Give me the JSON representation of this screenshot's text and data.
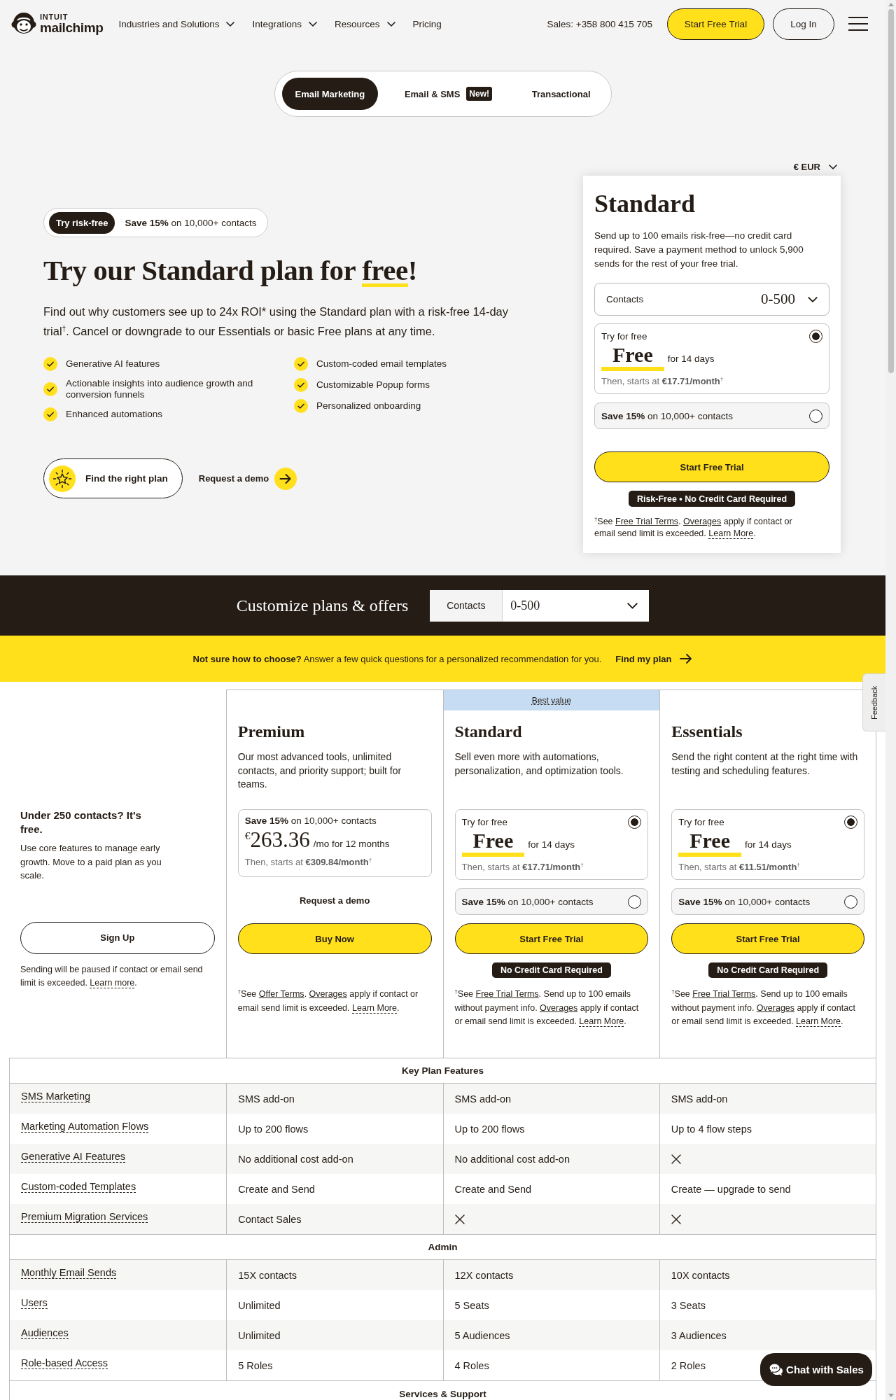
{
  "header": {
    "logo": {
      "brand": "INTUIT",
      "name": "mailchimp"
    },
    "nav": [
      {
        "label": "Industries and Solutions",
        "dropdown": true
      },
      {
        "label": "Integrations",
        "dropdown": true
      },
      {
        "label": "Resources",
        "dropdown": true
      },
      {
        "label": "Pricing",
        "dropdown": false
      }
    ],
    "sales": "Sales: +358 800 415 705",
    "buttons": [
      {
        "label": "Start Free Trial",
        "kind": "primary"
      },
      {
        "label": "Log In",
        "kind": "outline"
      }
    ]
  },
  "product_tabs": [
    {
      "label": "Email Marketing",
      "selected": true
    },
    {
      "label": "Email & SMS",
      "badge": "New!",
      "selected": false
    },
    {
      "label": "Transactional",
      "selected": false
    }
  ],
  "hero": {
    "offer": {
      "tag": "Try risk-free",
      "text": "**Save 15%** on 10,000+ contacts"
    },
    "title": {
      "before": "Try our Standard plan for",
      "highlight": "free",
      "after": "!"
    },
    "intro": "Find out why customers see up to 24x ROI* using the Standard plan with a risk-free 14-day trial$^{†}$. Cancel or downgrade to our Essentials or basic Free plans at any time.",
    "features": [
      [
        "Generative AI features",
        "Actionable insights into audience growth and conversion funnels",
        "Enhanced automations"
      ],
      [
        "Custom-coded email templates",
        "Customizable Popup forms",
        "Personalized onboarding"
      ]
    ],
    "actions": [
      {
        "kind": "finder",
        "label": "Find the right plan"
      },
      {
        "kind": "demo",
        "label": "Request a demo"
      }
    ],
    "currency": "€ EUR",
    "card": {
      "title": "Standard",
      "description": "Send up to 100 emails risk-free—no credit card required. Save a payment method to unlock 5,900 sends for the rest of your free trial.",
      "contacts": {
        "label": "Contacts",
        "value": "0-500"
      },
      "options": [
        {
          "kind": "trial",
          "label": "Try for free",
          "price": "Free",
          "period": "for 14 days",
          "then": "Then, starts at **€17.71/month**$^{†}$",
          "selected": true
        },
        {
          "kind": "discount",
          "text": "**Save 15%** on 10,000+ contacts",
          "selected": false
        }
      ],
      "button": "Start Free Trial",
      "tag": "Risk-Free • No Credit Card Required",
      "footnote": [
        {
          "kind": "text",
          "text": "$^{†}$See "
        },
        {
          "kind": "link",
          "text": "Free Trial Terms"
        },
        {
          "kind": "text",
          "text": ". "
        },
        {
          "kind": "link",
          "text": "Overages"
        },
        {
          "kind": "text",
          "text": " apply if contact or email send limit is exceeded. "
        },
        {
          "kind": "tooltip",
          "text": "Learn More"
        },
        {
          "kind": "text",
          "text": "."
        }
      ]
    }
  },
  "customize": {
    "title": "Customize plans & offers",
    "contacts": {
      "label": "Contacts",
      "value": "0-500"
    }
  },
  "helper": {
    "text": "**Not sure how to choose?** Answer a few quick questions for a personalized recommendation for you.",
    "link": "Find my plan"
  },
  "free_plan": {
    "title": "Under 250 contacts? It's free.",
    "description": "Use core features to manage early growth. Move to a paid plan as you scale.",
    "button": "Sign Up",
    "note": [
      {
        "kind": "text",
        "text": "Sending will be paused if contact or email send limit is exceeded. "
      },
      {
        "kind": "tooltip",
        "text": "Learn more"
      },
      {
        "kind": "text",
        "text": "."
      }
    ]
  },
  "plans": [
    {
      "name": "Premium",
      "description": "Our most advanced tools, unlimited contacts, and priority support; built for teams.",
      "options": [
        {
          "kind": "offer",
          "label": "**Save 15%** on 10,000+ contacts",
          "price": "$^{€}$263.36",
          "period": "/mo for 12 months",
          "then": "Then, starts at **€309.84/month**$^{†}$"
        }
      ],
      "demo_link": "Request a demo",
      "button": "Buy Now",
      "footnote": [
        {
          "kind": "text",
          "text": "$^{†}$See "
        },
        {
          "kind": "link",
          "text": "Offer Terms"
        },
        {
          "kind": "text",
          "text": ". "
        },
        {
          "kind": "link",
          "text": "Overages"
        },
        {
          "kind": "text",
          "text": " apply if contact or email send limit is exceeded. "
        },
        {
          "kind": "tooltip",
          "text": "Learn More"
        },
        {
          "kind": "text",
          "text": "."
        }
      ]
    },
    {
      "name": "Standard",
      "banner": "Best value",
      "description": "Sell even more with automations, personalization, and optimization tools.",
      "options": [
        {
          "kind": "trial",
          "label": "Try for free",
          "price": "Free",
          "period": "for 14 days",
          "then": "Then, starts at **€17.71/month**$^{†}$",
          "selected": true
        },
        {
          "kind": "discount",
          "text": "**Save 15%** on 10,000+ contacts",
          "selected": false
        }
      ],
      "button": "Start Free Trial",
      "tag": "No Credit Card Required",
      "footnote": [
        {
          "kind": "text",
          "text": "$^{†}$See "
        },
        {
          "kind": "link",
          "text": "Free Trial Terms"
        },
        {
          "kind": "text",
          "text": ". Send up to 100 emails without payment info. "
        },
        {
          "kind": "link",
          "text": "Overages"
        },
        {
          "kind": "text",
          "text": " apply if contact or email send limit is exceeded. "
        },
        {
          "kind": "tooltip",
          "text": "Learn More"
        },
        {
          "kind": "text",
          "text": "."
        }
      ]
    },
    {
      "name": "Essentials",
      "description": "Send the right content at the right time with testing and scheduling features.",
      "options": [
        {
          "kind": "trial",
          "label": "Try for free",
          "price": "Free",
          "period": "for 14 days",
          "then": "Then, starts at **€11.51/month**$^{†}$",
          "selected": true
        },
        {
          "kind": "discount",
          "text": "**Save 15%** on 10,000+ contacts",
          "selected": false
        }
      ],
      "button": "Start Free Trial",
      "tag": "No Credit Card Required",
      "footnote": [
        {
          "kind": "text",
          "text": "$^{†}$See "
        },
        {
          "kind": "link",
          "text": "Free Trial Terms"
        },
        {
          "kind": "text",
          "text": ". Send up to 100 emails without payment info. "
        },
        {
          "kind": "link",
          "text": "Overages"
        },
        {
          "kind": "text",
          "text": " apply if contact or email send limit is exceeded. "
        },
        {
          "kind": "tooltip",
          "text": "Learn More"
        },
        {
          "kind": "text",
          "text": "."
        }
      ]
    }
  ],
  "comparison": {
    "sections": [
      {
        "title": "Key Plan Features",
        "rows": [
          {
            "feature": "SMS Marketing",
            "cells": [
              {
                "kind": "text",
                "text": "SMS add-on"
              },
              {
                "kind": "text",
                "text": "SMS add-on"
              },
              {
                "kind": "text",
                "text": "SMS add-on"
              }
            ]
          },
          {
            "feature": "Marketing Automation Flows",
            "cells": [
              {
                "kind": "text",
                "text": "Up to 200 flows"
              },
              {
                "kind": "text",
                "text": "Up to 200 flows"
              },
              {
                "kind": "text",
                "text": "Up to 4 flow steps"
              }
            ]
          },
          {
            "feature": "Generative AI Features",
            "cells": [
              {
                "kind": "text",
                "text": "No additional cost add-on"
              },
              {
                "kind": "text",
                "text": "No additional cost add-on"
              },
              {
                "kind": "cross"
              }
            ]
          },
          {
            "feature": "Custom-coded Templates",
            "cells": [
              {
                "kind": "text",
                "text": "Create and Send"
              },
              {
                "kind": "text",
                "text": "Create and Send"
              },
              {
                "kind": "text",
                "text": "Create — upgrade to send"
              }
            ]
          },
          {
            "feature": "Premium Migration Services",
            "cells": [
              {
                "kind": "text",
                "text": "Contact Sales"
              },
              {
                "kind": "cross"
              },
              {
                "kind": "cross"
              }
            ]
          }
        ]
      },
      {
        "title": "Admin",
        "rows": [
          {
            "feature": "Monthly Email Sends",
            "cells": [
              {
                "kind": "text",
                "text": "15X contacts"
              },
              {
                "kind": "text",
                "text": "12X contacts"
              },
              {
                "kind": "text",
                "text": "10X contacts"
              }
            ]
          },
          {
            "feature": "Users",
            "cells": [
              {
                "kind": "text",
                "text": "Unlimited"
              },
              {
                "kind": "text",
                "text": "5 Seats"
              },
              {
                "kind": "text",
                "text": "3 Seats"
              }
            ]
          },
          {
            "feature": "Audiences",
            "cells": [
              {
                "kind": "text",
                "text": "Unlimited"
              },
              {
                "kind": "text",
                "text": "5 Audiences"
              },
              {
                "kind": "text",
                "text": "3 Audiences"
              }
            ]
          },
          {
            "feature": "Role-based Access",
            "cells": [
              {
                "kind": "text",
                "text": "5 Roles"
              },
              {
                "kind": "text",
                "text": "4 Roles"
              },
              {
                "kind": "text",
                "text": "2 Roles"
              }
            ]
          }
        ]
      },
      {
        "title": "Services & Support"
      }
    ]
  },
  "chat": "Chat with Sales",
  "feedback": "Feedback"
}
